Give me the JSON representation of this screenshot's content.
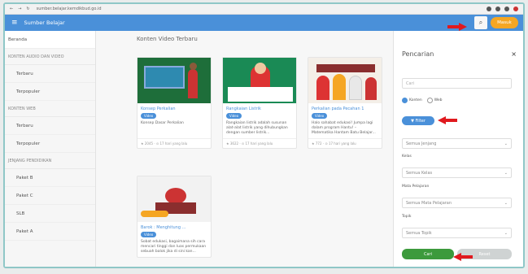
{
  "browser": {
    "url": "sumber.belajar.kemdikbud.go.id"
  },
  "app": {
    "title": "Sumber Belajar",
    "login_label": "Masuk"
  },
  "sidebar": {
    "home": "Beranda",
    "sections": [
      {
        "title": "KONTEN AUDIO DAN VIDEO",
        "items": [
          "Terbaru",
          "Terpopuler"
        ]
      },
      {
        "title": "KONTEN WEB",
        "items": [
          "Terbaru",
          "Terpopuler"
        ]
      },
      {
        "title": "JENJANG PENDIDIKAN",
        "items": [
          "Paket B",
          "Paket C",
          "SLB",
          "Paket A"
        ]
      }
    ]
  },
  "main": {
    "heading": "Konten Video Terbaru",
    "cards": [
      {
        "title": "Konsep Perkalian",
        "badge": "Video",
        "desc": "Konsep Dasar Perkalian",
        "views": "2045",
        "time": "17 hari yang lalu"
      },
      {
        "title": "Rangkaian Listrik",
        "badge": "Video",
        "desc": "Rangkaian listrik adalah susunan alat-alat listrik yang dihubungkan dengan sumber listrik...",
        "views": "3622",
        "time": "17 hari yang lalu"
      },
      {
        "title": "Perkalian pada Pecahan 1",
        "badge": "Video",
        "desc": "Halo sahabat edukasi! Jumpa lagi dalam program Hantu! – Matematika Hantam Batu Belajar...",
        "views": "772",
        "time": "17 hari yang lalu"
      },
      {
        "title": "Barok : Menghitung ...",
        "badge": "Video",
        "desc": "Sobat edukasi, bagaimana sih cara mencari tinggi dan luas permukaan sebuah balok jika di sini kan...",
        "views": "",
        "time": ""
      }
    ]
  },
  "panel": {
    "title": "Pencarian",
    "close": "×",
    "search_placeholder": "Cari",
    "radio_konten": "Konten",
    "radio_web": "Web",
    "filter_label": "Filter",
    "jenjang_value": "Semua Jenjang",
    "kelas_label": "Kelas",
    "kelas_value": "Semua Kelas",
    "mapel_label": "Mata Pelajaran",
    "mapel_value": "Semua Mata Pelajaran",
    "topik_label": "Topik",
    "topik_value": "Semua Topik",
    "cari_label": "Cari",
    "reset_label": "Reset"
  },
  "colors": {
    "appbar": "#4a90d9",
    "accent": "#f5a623",
    "cari": "#3c9a3c",
    "arrow": "#e0191e"
  }
}
